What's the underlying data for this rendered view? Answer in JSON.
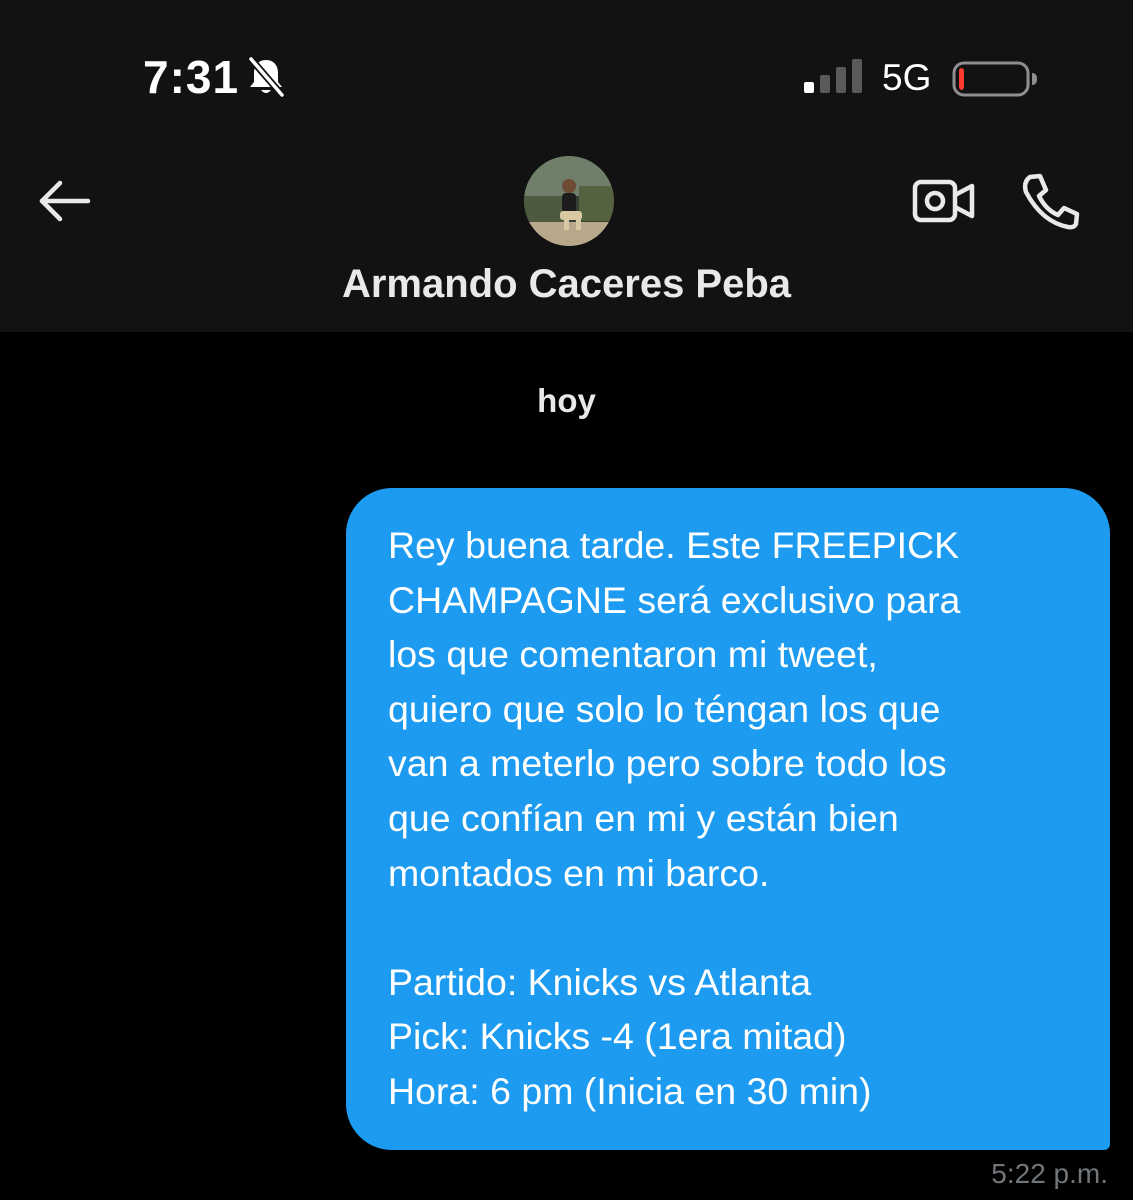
{
  "status_bar": {
    "time": "7:31",
    "network": "5G",
    "battery_level": 0.08,
    "signal_bars_active": 1,
    "icons": [
      "bell-slash-icon",
      "signal-icon",
      "battery-icon"
    ]
  },
  "header": {
    "contact_name": "Armando Caceres Peba",
    "icons": [
      "back-arrow-icon",
      "avatar",
      "video-camera-icon",
      "phone-icon"
    ]
  },
  "conversation": {
    "day_label": "hoy",
    "messages": [
      {
        "direction": "outgoing",
        "text": "Rey buena tarde. Este FREEPICK\nCHAMPAGNE será exclusivo para\nlos que comentaron mi tweet,\nquiero que solo lo téngan los que\nvan a meterlo pero sobre todo los\nque confían en mi y están bien\nmontados en mi barco.\n\nPartido: Knicks vs Atlanta\nPick: Knicks -4 (1era mitad)\nHora: 6 pm (Inicia en 30 min)",
        "time": "5:22 p.m."
      }
    ]
  },
  "colors": {
    "background": "#000000",
    "header_background": "#121213",
    "bubble": "#1d9bf0",
    "timestamp": "#71767b",
    "battery_low": "#ff3b30"
  }
}
